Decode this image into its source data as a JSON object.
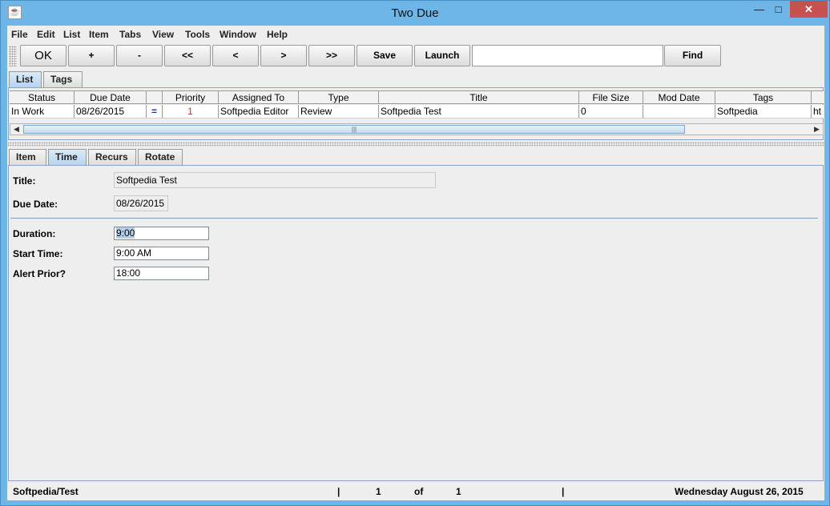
{
  "window": {
    "title": "Two Due",
    "app_icon": "java-cup-icon",
    "controls": {
      "minimize": "—",
      "maximize": "□",
      "close": "✕"
    }
  },
  "menu": [
    "File",
    "Edit",
    "List",
    "Item",
    "Tabs",
    "View",
    "Tools",
    "Window",
    "Help"
  ],
  "toolbar": {
    "buttons": [
      "OK",
      "+",
      "-",
      "<<",
      "<",
      ">",
      ">>",
      "Save",
      "Launch"
    ],
    "search_value": "",
    "find_label": "Find"
  },
  "top_tabs": [
    "List",
    "Tags"
  ],
  "table": {
    "columns": [
      "Status",
      "Due Date",
      "",
      "Priority",
      "Assigned To",
      "Type",
      "Title",
      "File Size",
      "Mod Date",
      "Tags",
      ""
    ],
    "rows": [
      [
        "In Work",
        "08/26/2015",
        "=",
        "1",
        "Softpedia Editor",
        "Review",
        "Softpedia Test",
        "0",
        "",
        "Softpedia",
        "ht"
      ]
    ]
  },
  "scroll": {
    "thumb_glyph": "|||",
    "left_arrow": "◀",
    "right_arrow": "▶"
  },
  "detail_tabs": [
    "Item",
    "Time",
    "Recurs",
    "Rotate"
  ],
  "detail": {
    "title_label": "Title:",
    "title_value": "Softpedia Test",
    "due_label": "Due Date:",
    "due_value": "08/26/2015",
    "duration_label": "Duration:",
    "duration_value": "9:00",
    "start_label": "Start Time:",
    "start_value": "9:00 AM",
    "alert_label": "Alert Prior?",
    "alert_value": "18:00"
  },
  "status": {
    "path": "Softpedia/Test",
    "sep1": "|",
    "current": "1",
    "of": "of",
    "total": "1",
    "sep2": "|",
    "date": "Wednesday August 26, 2015"
  }
}
